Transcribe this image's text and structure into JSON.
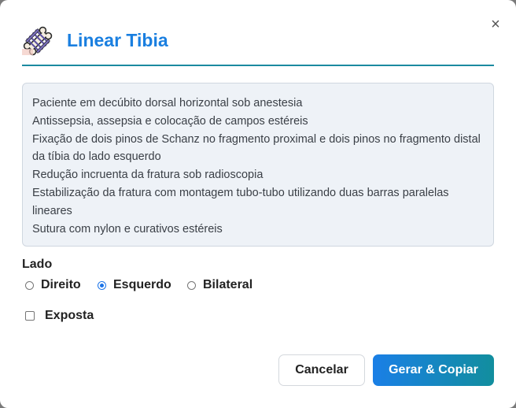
{
  "dialog": {
    "title": "Linear Tibia",
    "close_symbol": "×",
    "icon": "bone-fixator-icon"
  },
  "description_lines": [
    "Paciente em decúbito dorsal horizontal sob anestesia",
    "Antissepsia, assepsia e colocação de campos estéreis",
    "Fixação de dois pinos de Schanz no fragmento proximal e dois pinos no fragmento distal da tíbia do lado esquerdo",
    "Redução incruenta da fratura sob radioscopia",
    "Estabilização da fratura com montagem tubo-tubo utilizando duas barras paralelas lineares",
    "Sutura com nylon e curativos estéreis"
  ],
  "lado": {
    "label": "Lado",
    "options": [
      "Direito",
      "Esquerdo",
      "Bilateral"
    ],
    "selected": "Esquerdo"
  },
  "exposta": {
    "label": "Exposta",
    "checked": false
  },
  "buttons": {
    "cancel": "Cancelar",
    "submit": "Gerar & Copiar"
  },
  "colors": {
    "title": "#1a7fe0",
    "divider": "#1b8aa0",
    "primary_start": "#1a7fe6",
    "primary_end": "#128e9e"
  }
}
